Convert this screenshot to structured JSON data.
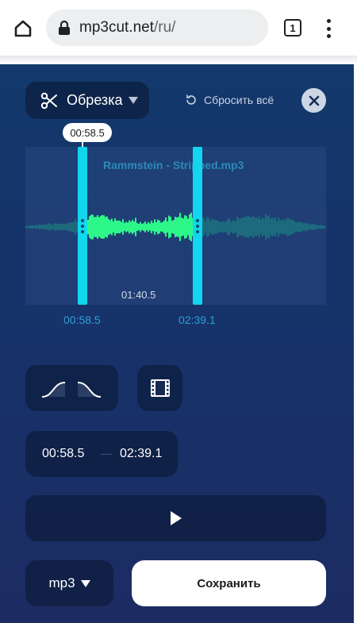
{
  "browser": {
    "url_host": "mp3cut.net",
    "url_path": "/ru/",
    "tab_count": "1"
  },
  "toolbar": {
    "mode_label": "Обрезка",
    "reset_label": "Сбросить всё"
  },
  "waveform": {
    "file_name": "Rammstein - Stripped.mp3",
    "tooltip_time": "00:58.5",
    "selection_duration": "01:40.5",
    "start_label": "00:58.5",
    "end_label": "02:39.1"
  },
  "range": {
    "start_value": "00:58.5",
    "end_value": "02:39.1"
  },
  "output": {
    "format": "mp3",
    "save_label": "Сохранить"
  },
  "colors": {
    "selected_wave": "#2ef78a",
    "unselected_wave": "#1c6a7c",
    "handle": "#11d6ee"
  },
  "icons": {
    "home": "home-icon",
    "lock": "lock-icon",
    "menu": "more-vert-icon",
    "scissors": "scissors-icon",
    "reset": "reset-icon",
    "close": "close-icon",
    "fade_in": "fade-in-icon",
    "fade_out": "fade-out-icon",
    "film": "film-icon",
    "play": "play-icon"
  }
}
